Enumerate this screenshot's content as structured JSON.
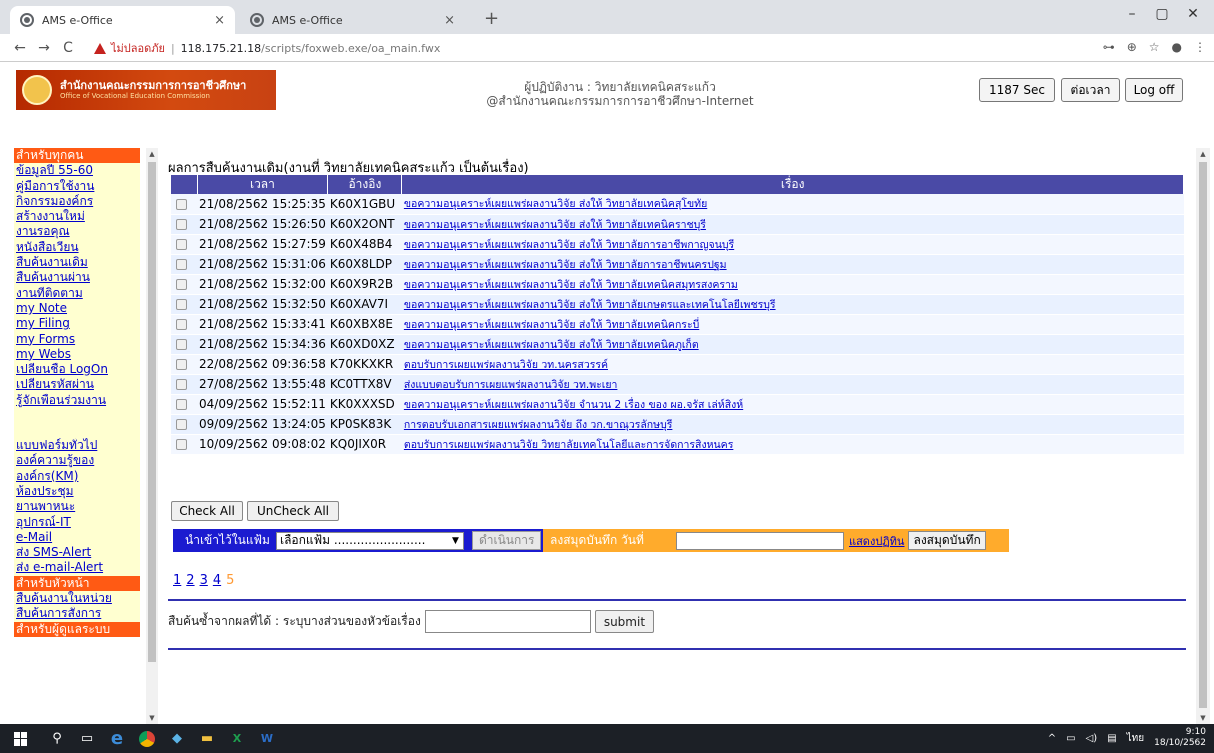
{
  "browser": {
    "tabs": [
      {
        "title": "AMS e-Office",
        "close": "×"
      },
      {
        "title": "AMS e-Office",
        "close": "×"
      }
    ],
    "new_tab": "+",
    "window_controls": [
      "–",
      "▢",
      "✕"
    ],
    "nav": {
      "back": "←",
      "forward": "→",
      "reload": "C"
    },
    "security_text": "ไม่ปลอดภัย",
    "url_host": "118.175.21.18",
    "url_path": "/scripts/foxweb.exe/oa_main.fwx",
    "toolbar_icons": [
      "key-icon",
      "zoom-icon",
      "star-icon",
      "profile-icon",
      "menu-icon"
    ],
    "toolbar_glyphs": [
      "⊶",
      "⊕",
      "☆",
      "●",
      "⋮"
    ]
  },
  "header": {
    "logo_th": "สำนักงานคณะกรรมการการอาชีวศึกษา",
    "logo_en": "Office of Vocational Education Commission",
    "operator_line": "ผู้ปฏิบัติงาน : วิทยาลัยเทคนิคสระแก้ว",
    "org_line": "@สำนักงานคณะกรรมการการอาชีวศึกษา-Internet",
    "session_timer": "1187 Sec",
    "extend_label": "ต่อเวลา",
    "logoff_label": "Log off"
  },
  "sidebar": {
    "section_all": "สำหรับทุกคน",
    "links_all": [
      "ข้อมูลปี 55-60",
      "คู่มือการใช้งาน",
      "กิจกรรมองค์กร",
      "สร้างงานใหม่",
      "งานรอคุณ",
      "หนังสือเวียน",
      "สืบค้นงานเดิม",
      "สืบค้นงานผ่าน",
      "งานที่ติดตาม",
      "my Note",
      "my Filing",
      "my Forms",
      "my Webs",
      "เปลี่ยนชื่อ LogOn",
      "เปลี่ยนรหัสผ่าน",
      "รู้จักเพื่อนร่วมงาน"
    ],
    "links_general": [
      "แบบฟอร์มทั่วไป",
      "องค์ความรู้ของ",
      "องค์กร(KM)",
      "ห้องประชุม",
      "ยานพาหนะ",
      "อุปกรณ์-IT",
      "e-Mail",
      "ส่ง SMS-Alert",
      "ส่ง e-mail-Alert"
    ],
    "section_head": "สำหรับหัวหน้า",
    "links_head": [
      "สืบค้นงานในหน่วย",
      "สืบค้นการสั่งการ"
    ],
    "section_admin": "สำหรับผู้ดูแลระบบ"
  },
  "main": {
    "title": "ผลการสืบค้นงานเดิม(งานที่ วิทยาลัยเทคนิคสระแก้ว เป็นต้นเรื่อง)",
    "columns": [
      "",
      "เวลา",
      "อ้างอิง",
      "เรื่อง"
    ],
    "rows": [
      {
        "time": "21/08/2562 15:25:35",
        "ref": "K60X1GBU",
        "subject": "ขอความอนุเคราะห์เผยแพร่ผลงานวิจัย ส่งให้ วิทยาลัยเทคนิคสุโขทัย"
      },
      {
        "time": "21/08/2562 15:26:50",
        "ref": "K60X2ONT",
        "subject": "ขอความอนุเคราะห์เผยแพร่ผลงานวิจัย ส่งให้ วิทยาลัยเทคนิคราชบุรี"
      },
      {
        "time": "21/08/2562 15:27:59",
        "ref": "K60X48B4",
        "subject": "ขอความอนุเคราะห์เผยแพร่ผลงานวิจัย ส่งให้ วิทยาลัยการอาชีพกาญจนบุรี"
      },
      {
        "time": "21/08/2562 15:31:06",
        "ref": "K60X8LDP",
        "subject": "ขอความอนุเคราะห์เผยแพร่ผลงานวิจัย ส่งให้ วิทยาลัยการอาชีพนครปฐม"
      },
      {
        "time": "21/08/2562 15:32:00",
        "ref": "K60X9R2B",
        "subject": "ขอความอนุเคราะห์เผยแพร่ผลงานวิจัย ส่งให้ วิทยาลัยเทคนิคสมุทรสงคราม"
      },
      {
        "time": "21/08/2562 15:32:50",
        "ref": "K60XAV7I",
        "subject": "ขอความอนุเคราะห์เผยแพร่ผลงานวิจัย ส่งให้ วิทยาลัยเกษตรและเทคโนโลยีเพชรบุรี"
      },
      {
        "time": "21/08/2562 15:33:41",
        "ref": "K60XBX8E",
        "subject": "ขอความอนุเคราะห์เผยแพร่ผลงานวิจัย ส่งให้ วิทยาลัยเทคนิคกระบี่"
      },
      {
        "time": "21/08/2562 15:34:36",
        "ref": "K60XD0XZ",
        "subject": "ขอความอนุเคราะห์เผยแพร่ผลงานวิจัย ส่งให้ วิทยาลัยเทคนิคภูเก็ต"
      },
      {
        "time": "22/08/2562 09:36:58",
        "ref": "K70KKXKR",
        "subject": "ตอบรับการเผยแพร่ผลงานวิจัย วท.นครสวรรค์"
      },
      {
        "time": "27/08/2562 13:55:48",
        "ref": "KC0TTX8V",
        "subject": "ส่งแบบตอบรับการเผยแพร่ผลงานวิจัย วท.พะเยา"
      },
      {
        "time": "04/09/2562 15:52:11",
        "ref": "KK0XXXSD",
        "subject": "ขอความอนุเคราะห์เผยแพร่ผลงานวิจัย จำนวน 2 เรื่อง ของ ผอ.จรัส เล่ห์สิงห์"
      },
      {
        "time": "09/09/2562 13:24:05",
        "ref": "KP0SK83K",
        "subject": "การตอบรับเอกสารเผยแพร่ผลงานวิจัย ถึง วก.ขาณุวรลักษบุรี"
      },
      {
        "time": "10/09/2562 09:08:02",
        "ref": "KQ0JIX0R",
        "subject": "ตอบรับการเผยแพร่ผลงานวิจัย วิทยาลัยเทคโนโลยีและการจัดการสิงหนคร"
      }
    ],
    "check_all": "Check All",
    "uncheck_all": "UnCheck All",
    "file_label": "นำเข้าไว้ในแฟ้ม",
    "file_select_value": "เลือกแฟ้ม ........................",
    "execute_label": "ดำเนินการ",
    "note_label": "ลงสมุดบันทึก วันที่",
    "show_calendar": "แสดงปฏิทิน",
    "note_button": "ลงสมุดบันทึก",
    "pages": [
      "1",
      "2",
      "3",
      "4"
    ],
    "current_page": "5",
    "search_label": "สืบค้นซ้ำจากผลที่ได้ : ระบุบางส่วนของหัวข้อเรื่อง",
    "submit_label": "submit"
  },
  "taskbar": {
    "lang": "ไทย",
    "time": "9:10",
    "date": "18/10/2562"
  }
}
